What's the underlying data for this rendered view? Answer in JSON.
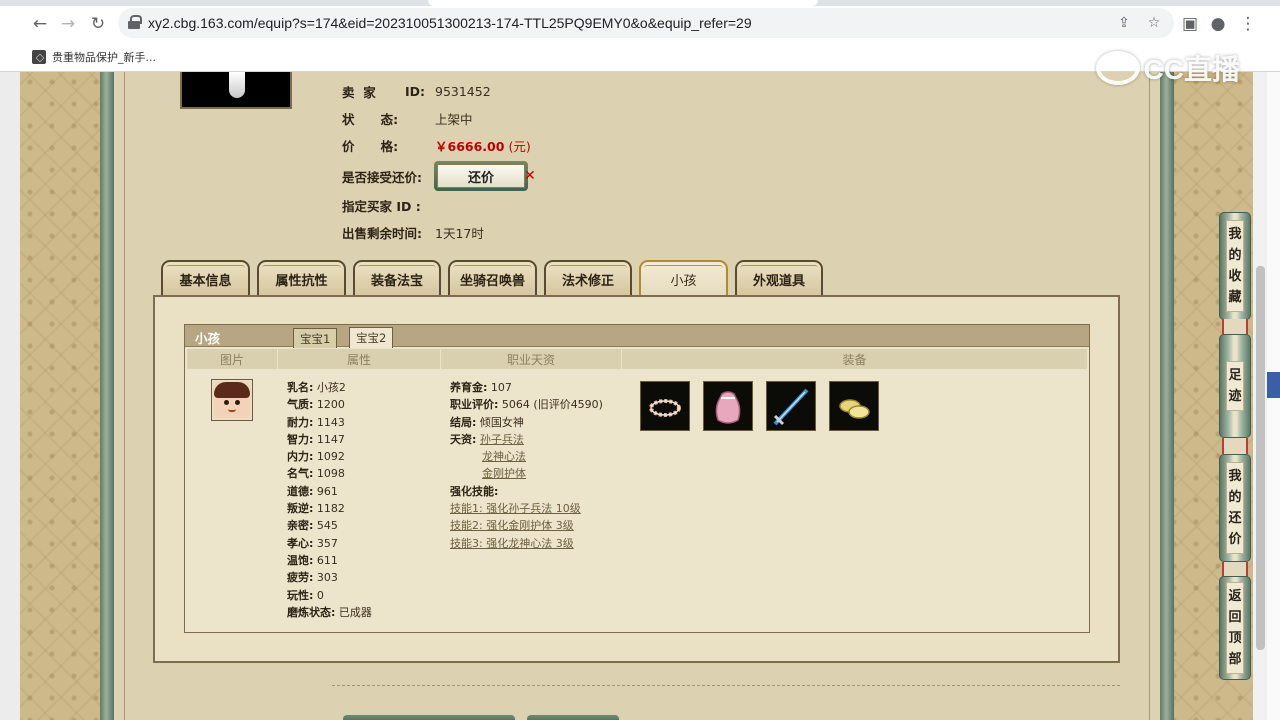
{
  "browser": {
    "url": "xy2.cbg.163.com/equip?s=174&eid=202310051300213-174-TTL25PQ9EMY0&o&equip_refer=29",
    "bookmark": "贵重物品保护_新手..."
  },
  "watermark": "CC直播",
  "seller": {
    "label_seller": "卖  家",
    "label_id": "ID:",
    "seller_id": "9531452",
    "label_status": "状      态:",
    "status": "上架中",
    "label_price": "价      格:",
    "price": "￥6666.00",
    "price_unit": "(元)",
    "label_counter": "是否接受还价:",
    "counter_button": "还价",
    "label_buyer": "指定买家 ID :",
    "label_time": "出售剩余时间:",
    "time_left": "1天17时"
  },
  "tabs": [
    "基本信息",
    "属性抗性",
    "装备法宝",
    "坐骑召唤兽",
    "法术修正",
    "小孩",
    "外观道具"
  ],
  "child_panel": {
    "title": "小孩",
    "subtabs": [
      "宝宝1",
      "宝宝2"
    ],
    "columns": [
      "图片",
      "属性",
      "职业天资",
      "装备"
    ],
    "attributes": [
      {
        "label": "乳名:",
        "value": "小孩2"
      },
      {
        "label": "气质:",
        "value": "1200"
      },
      {
        "label": "耐力:",
        "value": "1143"
      },
      {
        "label": "智力:",
        "value": "1147"
      },
      {
        "label": "内力:",
        "value": "1092"
      },
      {
        "label": "名气:",
        "value": "1098"
      },
      {
        "label": "道德:",
        "value": "961"
      },
      {
        "label": "叛逆:",
        "value": "1182"
      },
      {
        "label": "亲密:",
        "value": "545"
      },
      {
        "label": "孝心:",
        "value": "357"
      },
      {
        "label": "温饱:",
        "value": "611"
      },
      {
        "label": "疲劳:",
        "value": "303"
      },
      {
        "label": "玩性:",
        "value": "0"
      },
      {
        "label": "磨炼状态:",
        "value": "已成器"
      }
    ],
    "career": {
      "fund_label": "养育金:",
      "fund": "107",
      "rating_label": "职业评价:",
      "rating": "5064 (旧评价4590)",
      "ending_label": "结局:",
      "ending": "倾国女神",
      "talent_label": "天资:",
      "talents": [
        "孙子兵法",
        "龙神心法",
        "金刚护体"
      ],
      "skills_label": "强化技能:",
      "skills": [
        "技能1: 强化孙子兵法 10级",
        "技能2: 强化金刚护体 3级",
        "技能3: 强化龙神心法 3级"
      ]
    },
    "equipment": [
      "wreath-icon",
      "pink-bag-icon",
      "blue-sword-icon",
      "golden-shoes-icon"
    ]
  },
  "sidebar": {
    "favorites": "我的收藏",
    "footprint": "足迹",
    "my_counter": "我的还价",
    "back_top": "返回顶部"
  }
}
